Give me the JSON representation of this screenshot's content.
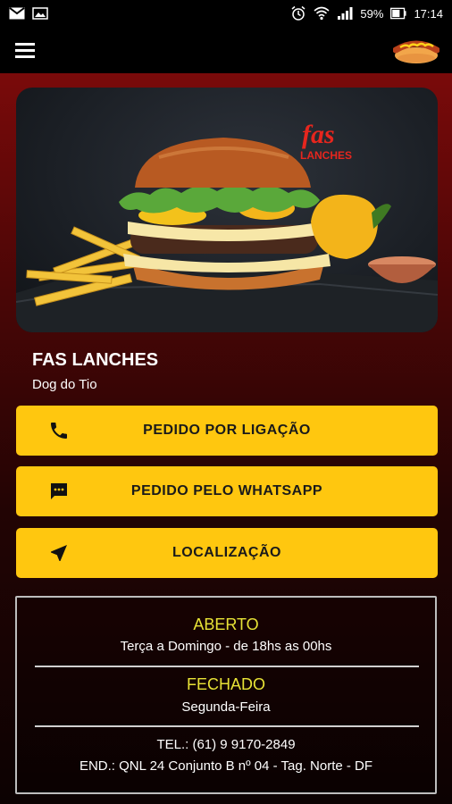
{
  "status_bar": {
    "battery": "59%",
    "time": "17:14",
    "icons": [
      "gmail-icon",
      "image-icon",
      "alarm-icon",
      "wifi-icon",
      "signal-icon",
      "battery-icon"
    ]
  },
  "app_bar": {
    "menu_icon": "hamburger-menu-icon",
    "logo_icon": "hotdog-icon"
  },
  "hero": {
    "logo_line1": "fas",
    "logo_line2": "LANCHES"
  },
  "store": {
    "name": "FAS LANCHES",
    "subtitle": "Dog do Tio"
  },
  "buttons": [
    {
      "label": "PEDIDO POR LIGAÇÃO",
      "icon": "phone-icon"
    },
    {
      "label": "PEDIDO PELO WHATSAPP",
      "icon": "chat-icon"
    },
    {
      "label": "LOCALIZAÇÃO",
      "icon": "navigation-icon"
    }
  ],
  "hours": {
    "open_label": "ABERTO",
    "open_days": "Terça a Domingo - de 18hs as 00hs",
    "closed_label": "FECHADO",
    "closed_days": "Segunda-Feira",
    "phone": "TEL.: (61) 9 9170-2849",
    "address": "END.: QNL 24 Conjunto B nº 04 - Tag. Norte - DF"
  },
  "colors": {
    "accent": "#ffc70f",
    "status_text": "#e8e336",
    "background_top": "#7a0a0a"
  }
}
